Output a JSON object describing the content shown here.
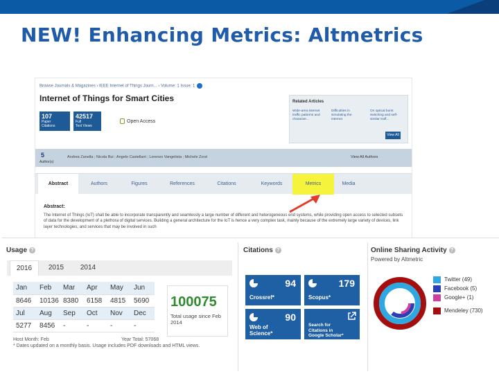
{
  "slide": {
    "title": "NEW! Enhancing Metrics: Altmetrics"
  },
  "article": {
    "breadcrumb": "Browse Journals & Magazines  ›  IEEE Internet of Things Journ...  ›  Volume: 1 Issue: 1",
    "title": "Internet of Things for Smart Cities",
    "metrics": [
      {
        "value": "107",
        "label": "Paper\nCitations"
      },
      {
        "value": "42517",
        "label": "Full\nText Views"
      }
    ],
    "open_access": "Open Access",
    "related": {
      "heading": "Related Articles",
      "items": [
        "Wide-area internet traffic patterns and character...",
        "Difficulties in simulating the internet",
        "On optical burst switching and self-similar traff..."
      ],
      "view_all": "View All"
    },
    "authors": {
      "count": "5",
      "count_label": "Author(s)",
      "names": "Andrea Zanella ;   Nicola Bui ;   Angelo Castellani ;   Lorenzo Vangelista ;   Michele Zorzi",
      "view_all": "View All Authors"
    },
    "tabs": [
      "Abstract",
      "Authors",
      "Figures",
      "References",
      "Citations",
      "Keywords",
      "Metrics",
      "Media"
    ],
    "abstract_heading": "Abstract:",
    "abstract_text": "The Internet of Things (IoT) shall be able to incorporate transparently and seamlessly a large number of different and heterogeneous end systems, while providing open access to selected subsets of data for the development of a plethora of digital services. Building a general architecture for the IoT is hence a very complex task, mainly because of the extremely large variety of devices, link layer technologies, and services that may be involved in such"
  },
  "usage": {
    "heading": "Usage",
    "years": [
      "2016",
      "2015",
      "2014"
    ],
    "months_row1": [
      "Jan",
      "Feb",
      "Mar",
      "Apr",
      "May",
      "Jun"
    ],
    "values_row1": [
      "8646",
      "10136",
      "8380",
      "6158",
      "4815",
      "5690"
    ],
    "months_row2": [
      "Jul",
      "Aug",
      "Sep",
      "Oct",
      "Nov",
      "Dec"
    ],
    "values_row2": [
      "5277",
      "8456",
      "-",
      "-",
      "-",
      "-"
    ],
    "total": "100075",
    "total_label": "Total usage since Feb 2014",
    "footer_left": "Host Month: Feb",
    "footer_right": "Year Total: 57068",
    "footnote": "* Dates updated on a monthly basis. Usage includes PDF downloads and HTML views."
  },
  "citations": {
    "heading": "Citations",
    "crossref": {
      "value": "94",
      "name": "Crossref*"
    },
    "scopus": {
      "value": "179",
      "name": "Scopus*"
    },
    "wos": {
      "value": "90",
      "name": "Web of Science*"
    },
    "scholar": "Search for Citations in Google Scholar*"
  },
  "sharing": {
    "heading": "Online Sharing Activity",
    "powered": "Powered by Altmetric",
    "legend": [
      {
        "label": "Twitter (49)",
        "color": "#2fa7e0"
      },
      {
        "label": "Facebook (5)",
        "color": "#2a3fb5"
      },
      {
        "label": "Google+ (1)",
        "color": "#d03fa0"
      },
      {
        "label": "Mendeley (730)",
        "color": "#a30f0f"
      }
    ]
  }
}
